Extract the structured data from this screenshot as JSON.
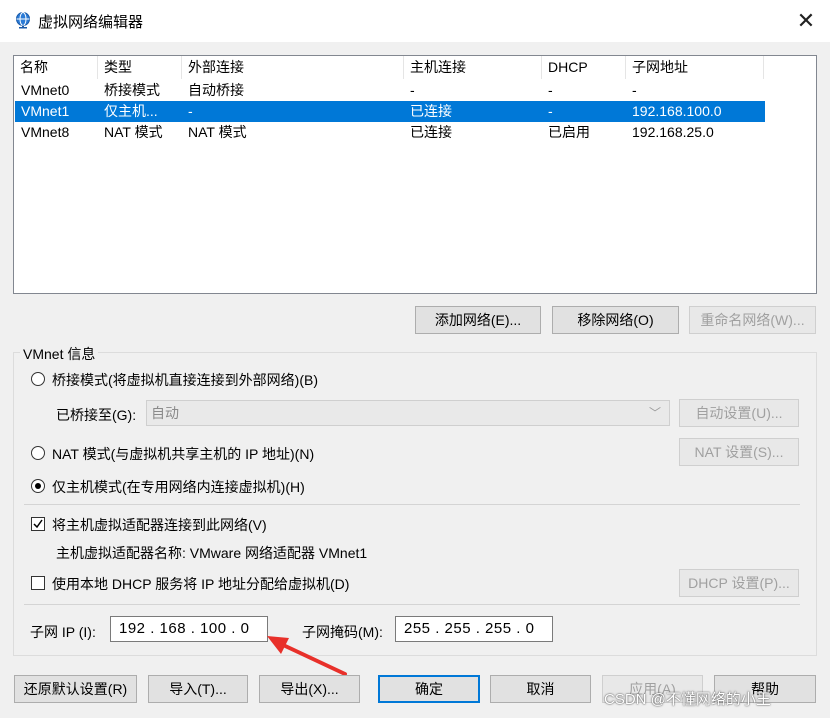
{
  "window": {
    "title": "虚拟网络编辑器",
    "close": "✕"
  },
  "table": {
    "headers": [
      "名称",
      "类型",
      "外部连接",
      "主机连接",
      "DHCP",
      "子网地址"
    ],
    "rows": [
      [
        "VMnet0",
        "桥接模式",
        "自动桥接",
        "-",
        "-",
        "-"
      ],
      [
        "VMnet1",
        "仅主机...",
        "-",
        "已连接",
        "-",
        "192.168.100.0"
      ],
      [
        "VMnet8",
        "NAT 模式",
        "NAT 模式",
        "已连接",
        "已启用",
        "192.168.25.0"
      ]
    ],
    "selected_row": 1
  },
  "network_buttons": {
    "add": "添加网络(E)...",
    "remove": "移除网络(O)",
    "rename": "重命名网络(W)..."
  },
  "vmnet_info": {
    "legend": "VMnet 信息",
    "bridge_radio": "桥接模式(将虚拟机直接连接到外部网络)(B)",
    "bridged_to_label": "已桥接至(G):",
    "bridged_to_value": "自动",
    "auto_settings": "自动设置(U)...",
    "nat_radio": "NAT 模式(与虚拟机共享主机的 IP 地址)(N)",
    "nat_settings": "NAT 设置(S)...",
    "hostonly_radio": "仅主机模式(在专用网络内连接虚拟机)(H)",
    "connect_adapter": "将主机虚拟适配器连接到此网络(V)",
    "adapter_name": "主机虚拟适配器名称: VMware 网络适配器 VMnet1",
    "use_dhcp": "使用本地 DHCP 服务将 IP 地址分配给虚拟机(D)",
    "dhcp_settings": "DHCP 设置(P)...",
    "subnet_ip_label": "子网 IP (I):",
    "subnet_ip": "192 . 168 . 100 .  0",
    "subnet_mask_label": "子网掩码(M):",
    "subnet_mask": "255 . 255 . 255 .  0"
  },
  "bottom_buttons": {
    "restore": "还原默认设置(R)",
    "import": "导入(T)...",
    "export": "导出(X)...",
    "ok": "确定",
    "cancel": "取消",
    "apply": "应用(A)",
    "help": "帮助"
  },
  "watermark": "CSDN @不懂网络的小王",
  "colors": {
    "selection": "#0078d7",
    "arrow": "#e8302a"
  }
}
